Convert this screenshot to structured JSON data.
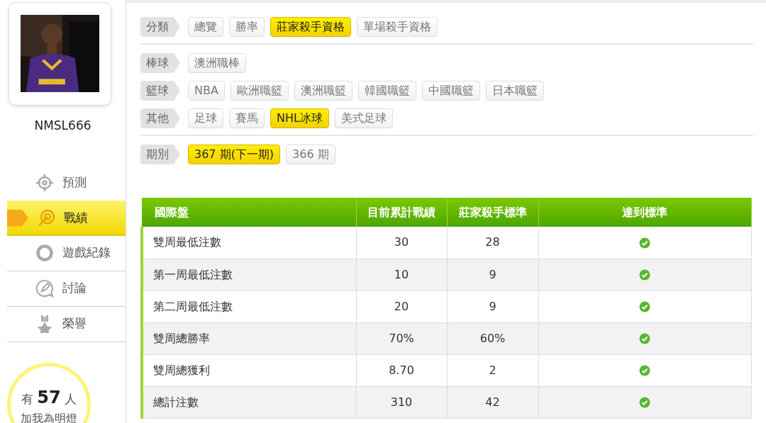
{
  "profile": {
    "username": "NMSL666"
  },
  "menu": [
    {
      "label": "預測",
      "selected": false
    },
    {
      "label": "戰績",
      "selected": true
    },
    {
      "label": "遊戲紀錄",
      "selected": false
    },
    {
      "label": "討論",
      "selected": false
    },
    {
      "label": "榮譽",
      "selected": false
    }
  ],
  "fans": {
    "prefix": "有",
    "count": "57",
    "suffix": "人",
    "caption": "加我為明燈"
  },
  "filter_sections": [
    [
      {
        "label": "分類",
        "options": [
          {
            "label": "總覽",
            "selected": false
          },
          {
            "label": "勝率",
            "selected": false
          },
          {
            "label": "莊家殺手資格",
            "selected": true
          },
          {
            "label": "單場殺手資格",
            "selected": false
          }
        ]
      }
    ],
    [
      {
        "label": "棒球",
        "options": [
          {
            "label": "澳洲職棒",
            "selected": false
          }
        ]
      },
      {
        "label": "籃球",
        "options": [
          {
            "label": "NBA",
            "selected": false
          },
          {
            "label": "歐洲職籃",
            "selected": false
          },
          {
            "label": "澳洲職籃",
            "selected": false
          },
          {
            "label": "韓國職籃",
            "selected": false
          },
          {
            "label": "中國職籃",
            "selected": false
          },
          {
            "label": "日本職籃",
            "selected": false
          }
        ]
      },
      {
        "label": "其他",
        "options": [
          {
            "label": "足球",
            "selected": false
          },
          {
            "label": "賽馬",
            "selected": false
          },
          {
            "label": "NHL冰球",
            "selected": true
          },
          {
            "label": "美式足球",
            "selected": false
          }
        ]
      }
    ],
    [
      {
        "label": "期別",
        "options": [
          {
            "label": "367 期(下一期)",
            "selected": true
          },
          {
            "label": "366 期",
            "selected": false
          }
        ]
      }
    ]
  ],
  "table": {
    "columns": [
      "國際盤",
      "目前累計戰績",
      "莊家殺手標準",
      "達到標準"
    ],
    "rows": [
      {
        "name": "雙周最低注數",
        "current": "30",
        "standard": "28",
        "met": true
      },
      {
        "name": "第一周最低注數",
        "current": "10",
        "standard": "9",
        "met": true
      },
      {
        "name": "第二周最低注數",
        "current": "20",
        "standard": "9",
        "met": true
      },
      {
        "name": "雙周總勝率",
        "current": "70%",
        "standard": "60%",
        "met": true
      },
      {
        "name": "雙周總獲利",
        "current": "8.70",
        "standard": "2",
        "met": true
      },
      {
        "name": "總計注數",
        "current": "310",
        "standard": "42",
        "met": true
      }
    ]
  }
}
